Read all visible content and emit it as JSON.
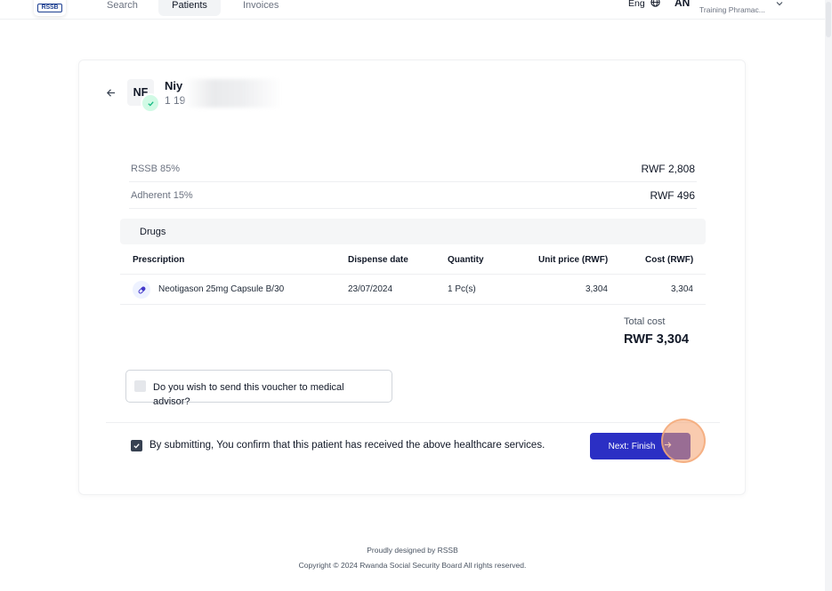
{
  "nav": {
    "logo_text": "RSSB",
    "tabs": [
      {
        "label": "Search"
      },
      {
        "label": "Patients"
      },
      {
        "label": "Invoices"
      }
    ],
    "language": "Eng",
    "user_initials": "AN",
    "user_role": "Training Phramac..."
  },
  "patient": {
    "initials": "NF",
    "name": "Niy",
    "id": "1 19"
  },
  "coverage": [
    {
      "label": "RSSB 85%",
      "value": "RWF 2,808"
    },
    {
      "label": "Adherent 15%",
      "value": "RWF 496"
    }
  ],
  "drugs": {
    "section_title": "Drugs",
    "headers": {
      "prescription": "Prescription",
      "dispense_date": "Dispense date",
      "quantity": "Quantity",
      "unit_price": "Unit price (RWF)",
      "cost": "Cost (RWF)"
    },
    "rows": [
      {
        "prescription": "Neotigason 25mg Capsule B/30",
        "dispense_date": "23/07/2024",
        "quantity": "1 Pc(s)",
        "unit_price": "3,304",
        "cost": "3,304"
      }
    ],
    "total_label": "Total cost",
    "total_value": "RWF 3,304"
  },
  "voucher": {
    "question": "Do you wish to send this voucher to medical advisor?",
    "checked": false
  },
  "confirm": {
    "text": "By submitting, You confirm that this patient has received the above healthcare services.",
    "checked": true
  },
  "next_button": {
    "label": "Next: Finish"
  },
  "footer": {
    "designed_by": "Proudly designed by RSSB",
    "copyright": "Copyright © 2024 Rwanda Social Security Board All rights reserved."
  },
  "colors": {
    "primary": "#2b2fc4",
    "verified": "#d1fae5",
    "click_highlight": "#f4a06e"
  },
  "icons": [
    "arrow-left-icon",
    "check-icon",
    "globe-icon",
    "chevron-down-icon",
    "pill-icon",
    "arrow-right-icon"
  ]
}
